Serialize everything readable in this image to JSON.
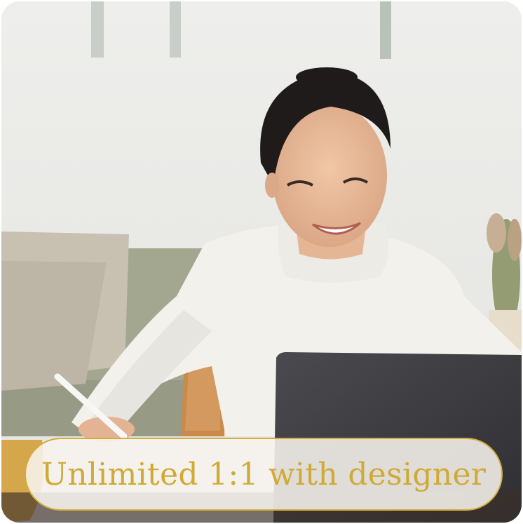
{
  "feature_card": {
    "photo_subject": "woman-at-laptop-photo",
    "caption": "Unlimited 1:1 with designer",
    "colors": {
      "caption_text": "#d0aa36",
      "pill_border": "#d2ad3b",
      "pill_background": "#f7f4ee"
    }
  }
}
